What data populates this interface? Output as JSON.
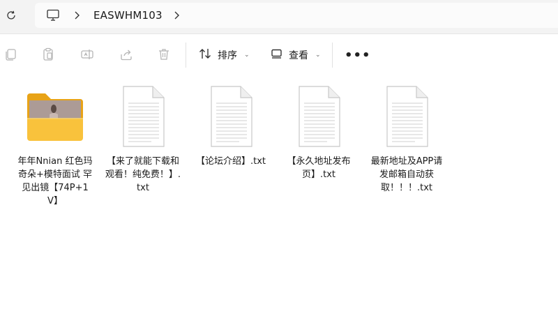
{
  "address": {
    "breadcrumb": "EASWHM103"
  },
  "toolbar": {
    "sort_label": "排序",
    "view_label": "查看",
    "more_label": "•••"
  },
  "files": [
    {
      "name": "年年Nnian 红色玛奇朵+模特面试 罕见出镜【74P+1V】",
      "type": "folder"
    },
    {
      "name": "【来了就能下载和观看！纯免费！】.txt",
      "type": "txt"
    },
    {
      "name": "【论坛介绍】.txt",
      "type": "txt"
    },
    {
      "name": "【永久地址发布页】.txt",
      "type": "txt"
    },
    {
      "name": "最新地址及APP请发邮箱自动获取！！！.txt",
      "type": "txt"
    }
  ],
  "colors": {
    "folder_front": "#f9c23c",
    "folder_back": "#e8a317",
    "accent": "#005fb8"
  }
}
